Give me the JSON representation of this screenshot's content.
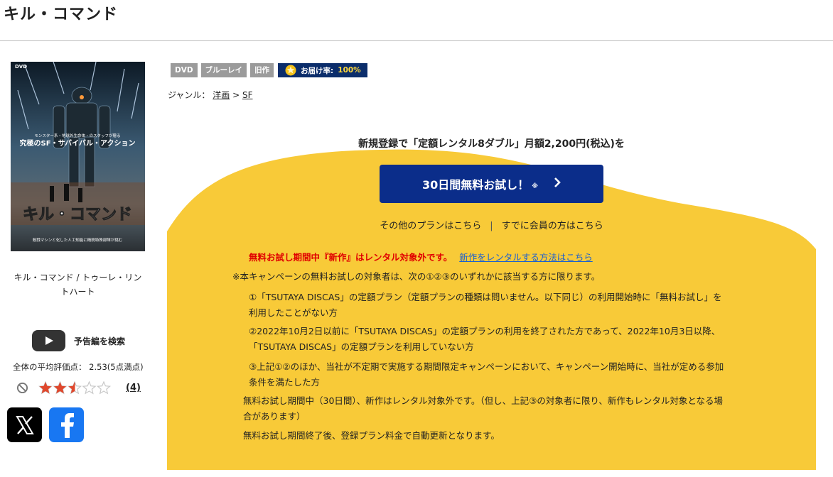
{
  "title": "キル・コマンド",
  "product": {
    "name": "キル・コマンド / トゥーレ・リントハート",
    "poster": {
      "label": "DVD",
      "logo_text": "キル・コマンド",
      "catch_small": "モンスター系・地球外生命体・のスタッフが贈る",
      "catch_big": "究極のSF・サバイバル・アクション",
      "bottom_text": "殺戮マシンと化した人工知能に精鋭特殊部隊が挑む"
    },
    "trailer_label": "予告編を検索",
    "rating_label": "全体の平均評価点： 2.53(5点満点)",
    "rating_value": 2.53,
    "rating_max": 5,
    "review_count": "(4)"
  },
  "tags": [
    "DVD",
    "ブルーレイ",
    "旧作"
  ],
  "delivery": {
    "label": "お届け率:",
    "value": "100%"
  },
  "genre": {
    "prefix": "ジャンル：",
    "parent": "洋画",
    "sep": ">",
    "child": "SF"
  },
  "campaign": {
    "heading": "新規登録で「定額レンタル8ダブル」月額2,200円(税込)を",
    "button_label": "30日間無料お試し！",
    "button_note": "※",
    "other_plans": "その他のプランはこちら",
    "separator": "|",
    "member_link": "すでに会員の方はこちら",
    "notice_red": "無料お試し期間中『新作』はレンタル対象外です。",
    "notice_link": "新作をレンタルする方法はこちら",
    "terms_intro": "※本キャンペーンの無料お試しの対象者は、次の①②③のいずれかに該当する方に限ります。",
    "terms_items": [
      [
        "①「TSUTAYA DISCAS」の定額プラン（定額プランの種類は問いません。以下同じ）の利用開始時に「無料お試し」を",
        "利用したことがない方"
      ],
      [
        "②2022年10月2日以前に「TSUTAYA DISCAS」の定額プランの利用を終了された方であって、2022年10月3日以降、",
        "「TSUTAYA DISCAS」の定額プランを利用していない方"
      ],
      [
        "③上記①②のほか、当社が不定期で実施する期間限定キャンペーンにおいて、キャンペーン開始時に、当社が定める参加",
        "条件を満たした方"
      ]
    ],
    "note_1": [
      "無料お試し期間中（30日間）、新作はレンタル対象外です。（但し、上記③の対象者に限り、新作もレンタル対象となる場",
      "合があります）"
    ],
    "note_2": "無料お試し期間終了後、登録プラン料金で自動更新となります。"
  },
  "colors": {
    "campaign_yellow": "#f8ca38",
    "button_navy": "#0b2d8a",
    "notice_red": "#e00000",
    "link_blue": "#1a5fd1",
    "star": "#e0482d"
  },
  "icons": {
    "trailer": "youtube-play-icon",
    "ban": "ban-icon",
    "share_x": "x-logo-icon",
    "share_fb": "facebook-logo-icon",
    "delivery": "star-badge-icon",
    "chevron": "chevron-right-icon"
  }
}
